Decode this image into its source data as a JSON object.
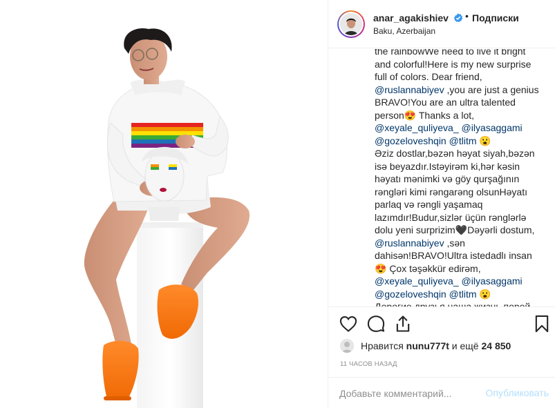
{
  "post": {
    "username": "anar_agakishiev",
    "separator": "•",
    "follow_label": "Подписки",
    "location": "Baku, Azerbaijan",
    "verified_icon": "verified-badge-icon"
  },
  "caption": {
    "segments": [
      {
        "t": "text",
        "v": "the rainbowWe need to live it bright and colorful!Here is my new surprise full of colors. Dear friend, "
      },
      {
        "t": "mention",
        "v": "@ruslannabiyev"
      },
      {
        "t": "text",
        "v": " ,you are just a genius BRAVO!You are an ultra talented person😍 Thanks a lot, "
      },
      {
        "t": "mention",
        "v": "@xeyale_quliyeva_"
      },
      {
        "t": "text",
        "v": " "
      },
      {
        "t": "mention",
        "v": "@ilyasaggami"
      },
      {
        "t": "text",
        "v": " "
      },
      {
        "t": "mention",
        "v": "@gozeloveshqin"
      },
      {
        "t": "text",
        "v": " "
      },
      {
        "t": "mention",
        "v": "@tlitm"
      },
      {
        "t": "text",
        "v": " 😮\nƏziz dostlar,bəzən həyat siyah,bəzən isə beyazdır.Istəyirəm ki,hər kəsin həyatı mənimki və göy qurşağının rəngləri kimi rəngarəng olsunHəyatı parlaq və rəngli yaşamaq lazımdır!Budur,sizlər üçün rənglərlə dolu yeni surprizim🖤Dəyərli dostum, "
      },
      {
        "t": "mention",
        "v": "@ruslannabiyev"
      },
      {
        "t": "text",
        "v": " ,sən dahisən!BRAVO!Ultra istedadlı insan😍 Çox təşəkkür edirəm, "
      },
      {
        "t": "mention",
        "v": "@xeyale_quliyeva_"
      },
      {
        "t": "text",
        "v": " "
      },
      {
        "t": "mention",
        "v": "@ilyasaggami"
      },
      {
        "t": "text",
        "v": " "
      },
      {
        "t": "mention",
        "v": "@gozeloveshqin"
      },
      {
        "t": "text",
        "v": " "
      },
      {
        "t": "mention",
        "v": "@tlitm"
      },
      {
        "t": "text",
        "v": " 😮\nДорогие друзья,наша жизнь порой"
      }
    ]
  },
  "actions": {
    "like_icon": "heart-icon",
    "comment_icon": "comment-bubble-icon",
    "share_icon": "share-icon",
    "save_icon": "bookmark-icon"
  },
  "likes": {
    "prefix": "Нравится ",
    "user": "nunu777t",
    "middle": " и ещё ",
    "count": "24 850"
  },
  "timestamp": "11 часов назад",
  "comment": {
    "placeholder": "Добавьте комментарий...",
    "publish_label": "Опубликовать"
  },
  "colors": {
    "mention": "#003569",
    "publish_disabled": "#b2dffc",
    "verified": "#3897f0",
    "shoe_orange": "#ff7a1a"
  }
}
